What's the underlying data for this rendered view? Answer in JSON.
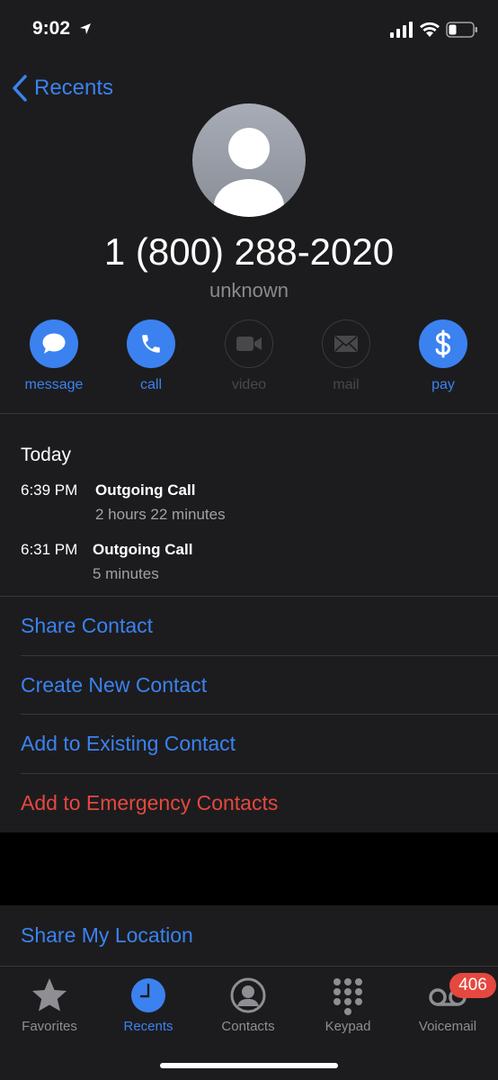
{
  "status": {
    "time": "9:02"
  },
  "nav": {
    "back_label": "Recents"
  },
  "contact": {
    "name": "1 (800) 288-2020",
    "subtitle": "unknown"
  },
  "actions": [
    {
      "label": "message",
      "enabled": true,
      "icon": "message-bubble-icon"
    },
    {
      "label": "call",
      "enabled": true,
      "icon": "phone-icon"
    },
    {
      "label": "video",
      "enabled": false,
      "icon": "video-camera-icon"
    },
    {
      "label": "mail",
      "enabled": false,
      "icon": "envelope-icon"
    },
    {
      "label": "pay",
      "enabled": true,
      "icon": "dollar-icon"
    }
  ],
  "history": {
    "heading": "Today",
    "calls": [
      {
        "time": "6:39 PM",
        "type": "Outgoing Call",
        "duration": "2 hours 22 minutes"
      },
      {
        "time": "6:31 PM",
        "type": "Outgoing Call",
        "duration": "5 minutes"
      }
    ]
  },
  "options": {
    "share_contact": "Share Contact",
    "create_new_contact": "Create New Contact",
    "add_existing": "Add to Existing Contact",
    "add_emergency": "Add to Emergency Contacts",
    "share_location": "Share My Location"
  },
  "tabs": [
    {
      "label": "Favorites",
      "icon": "star-icon",
      "active": false
    },
    {
      "label": "Recents",
      "icon": "clock-icon",
      "active": true
    },
    {
      "label": "Contacts",
      "icon": "person-circle-icon",
      "active": false
    },
    {
      "label": "Keypad",
      "icon": "keypad-icon",
      "active": false
    },
    {
      "label": "Voicemail",
      "icon": "voicemail-icon",
      "active": false
    }
  ],
  "voicemail_badge": "406",
  "colors": {
    "accent": "#3b82f0",
    "destructive": "#e5483f",
    "background": "#1c1c1e",
    "secondary_text": "#8a8a8e"
  }
}
